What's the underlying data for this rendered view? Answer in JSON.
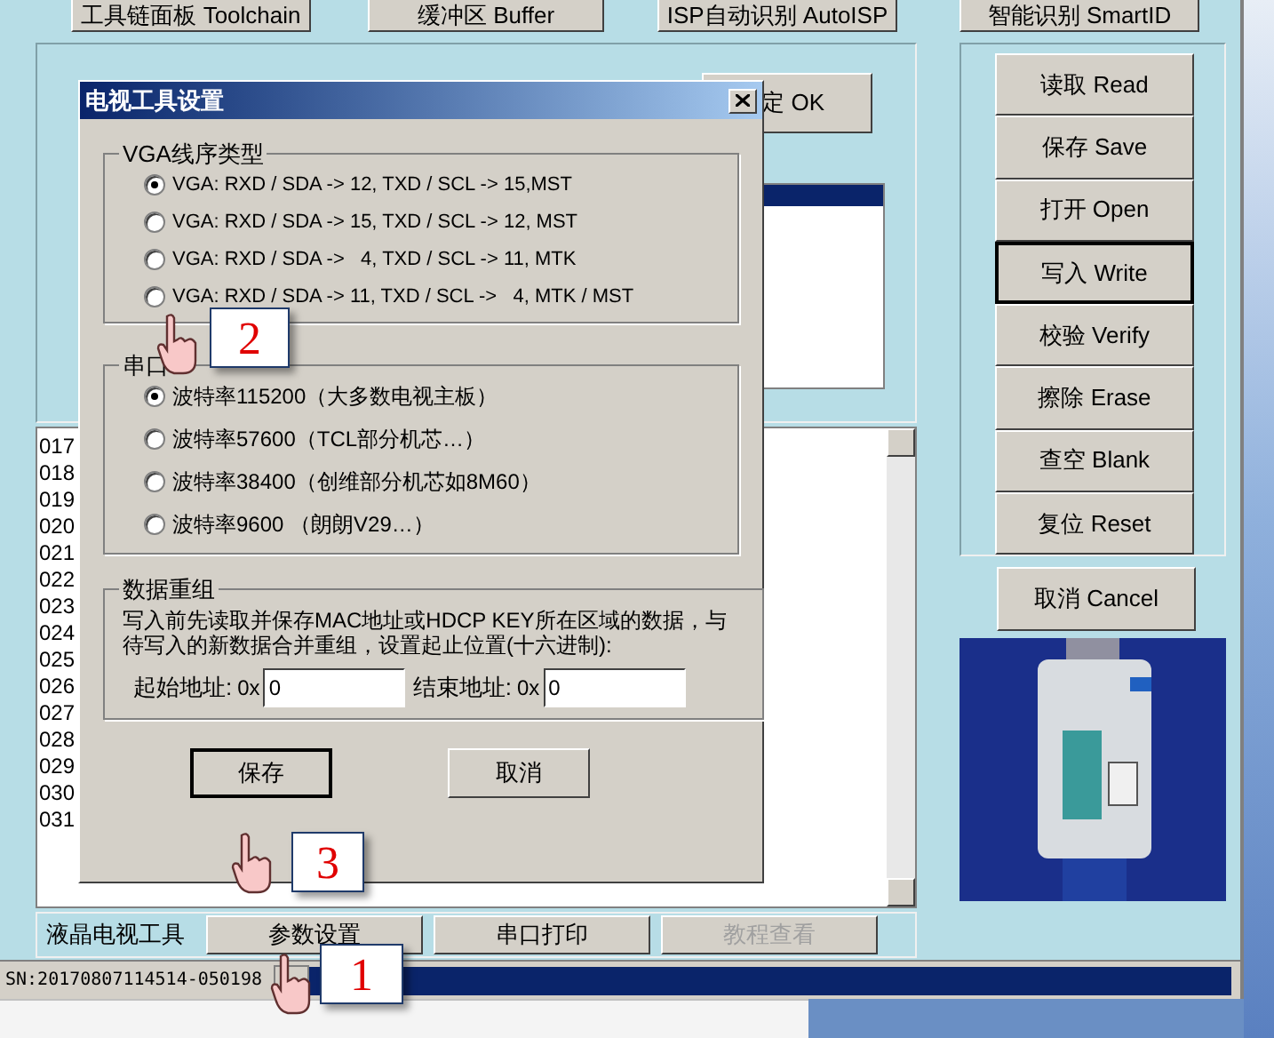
{
  "toolbar_top": [
    "工具链面板 Toolchain",
    "缓冲区 Buffer",
    "ISP自动识别 AutoISP",
    "智能识别 SmartID"
  ],
  "chip_panel": {
    "ok_button": "定 OK"
  },
  "log": {
    "lines": [
      "017",
      "018",
      "019",
      "020",
      "021",
      "022",
      "023",
      "024",
      "025",
      "026",
      "027",
      "028",
      "029",
      "030",
      "031"
    ]
  },
  "bottom_toolbar": {
    "label": "液晶电视工具",
    "buttons": [
      {
        "label": "参数设置",
        "disabled": false
      },
      {
        "label": "串口打印",
        "disabled": false
      },
      {
        "label": "教程查看",
        "disabled": true
      }
    ]
  },
  "status_bar": {
    "serial": "SN:20170807114514-050198"
  },
  "actions": [
    {
      "label": "读取 Read",
      "focused": false
    },
    {
      "label": "保存 Save",
      "focused": false
    },
    {
      "label": "打开 Open",
      "focused": false
    },
    {
      "label": "写入 Write",
      "focused": true
    },
    {
      "label": "校验 Verify",
      "focused": false
    },
    {
      "label": "擦除 Erase",
      "focused": false
    },
    {
      "label": "查空 Blank",
      "focused": false
    },
    {
      "label": "复位 Reset",
      "focused": false
    }
  ],
  "cancel_button": "取消 Cancel",
  "dialog": {
    "title": "电视工具设置",
    "vga_group": {
      "title": "VGA线序类型",
      "options": [
        {
          "label": "VGA: RXD / SDA -> 12, TXD / SCL -> 15,MST",
          "selected": true
        },
        {
          "label": "VGA: RXD / SDA -> 15, TXD / SCL -> 12, MST",
          "selected": false
        },
        {
          "label": "VGA: RXD / SDA ->   4, TXD / SCL -> 11, MTK",
          "selected": false
        },
        {
          "label": "VGA: RXD / SDA -> 11, TXD / SCL ->   4, MTK / MST",
          "selected": false
        }
      ]
    },
    "serial_group": {
      "title": "串口",
      "options": [
        {
          "label": "波特率115200（大多数电视主板）",
          "selected": true
        },
        {
          "label": "波特率57600（TCL部分机芯…）",
          "selected": false
        },
        {
          "label": "波特率38400（创维部分机芯如8M60）",
          "selected": false
        },
        {
          "label": "波特率9600 （朗朗V29…）",
          "selected": false
        }
      ]
    },
    "regroup": {
      "title": "数据重组",
      "description": "写入前先读取并保存MAC地址或HDCP KEY所在区域的数据，与待写入的新数据合并重组，设置起止位置(十六进制):",
      "fields": [
        {
          "label": "起始地址:",
          "prefix": "0x",
          "value": "0"
        },
        {
          "label": "结束地址:",
          "prefix": "0x",
          "value": "0"
        }
      ]
    },
    "buttons": [
      "保存",
      "取消"
    ]
  },
  "callouts": [
    "1",
    "2",
    "3"
  ]
}
